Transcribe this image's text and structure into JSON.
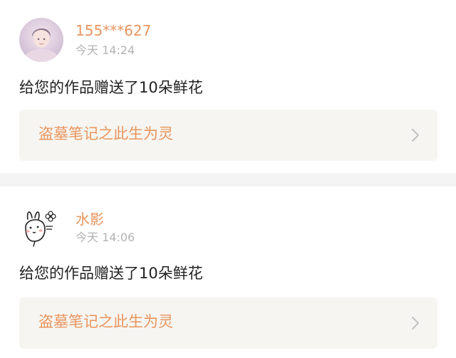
{
  "gifts": [
    {
      "username": "155***627",
      "timestamp": "今天 14:24",
      "message": "给您的作品赠送了10朵鲜花",
      "work_title": "盗墓笔记之此生为灵",
      "avatar_icon": "user-photo-avatar"
    },
    {
      "username": "水影",
      "timestamp": "今天 14:06",
      "message": "给您的作品赠送了10朵鲜花",
      "work_title": "盗墓笔记之此生为灵",
      "avatar_icon": "cartoon-rabbit-avatar"
    }
  ],
  "colors": {
    "accent": "#e8955e",
    "timestamp": "#b3b3b3",
    "message": "#222222",
    "link_background": "#f6f5f1",
    "separator": "#f4f4f4",
    "chevron": "#c4c4c4"
  },
  "icons": {
    "chevron": "chevron-right-icon"
  }
}
